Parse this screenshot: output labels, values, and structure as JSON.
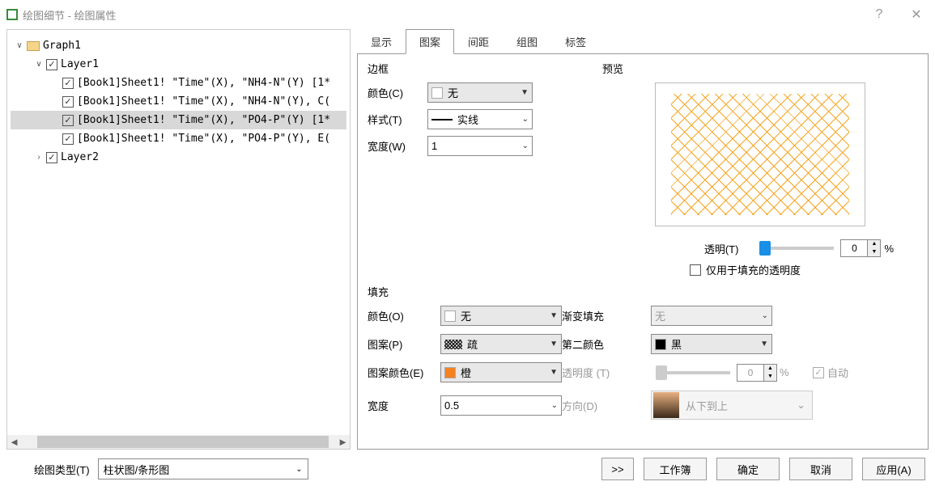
{
  "window": {
    "title": "绘图细节 - 绘图属性",
    "help": "?",
    "close": "✕"
  },
  "tree": {
    "root": "Graph1",
    "layer1": "Layer1",
    "layer2": "Layer2",
    "items": [
      "[Book1]Sheet1! \"Time\"(X), \"NH4-N\"(Y) [1*",
      "[Book1]Sheet1! \"Time\"(X), \"NH4-N\"(Y), C(",
      "[Book1]Sheet1! \"Time\"(X), \"PO4-P\"(Y) [1*",
      "[Book1]Sheet1! \"Time\"(X), \"PO4-P\"(Y), E("
    ]
  },
  "tabs": [
    "显示",
    "图案",
    "间距",
    "组图",
    "标签"
  ],
  "border": {
    "legend": "边框",
    "color_label": "颜色(C)",
    "color_value": "无",
    "style_label": "样式(T)",
    "style_value": "实线",
    "width_label": "宽度(W)",
    "width_value": "1"
  },
  "preview": {
    "legend": "预览"
  },
  "transparency": {
    "label": "透明(T)",
    "value": "0",
    "pct": "%",
    "fill_only": "仅用于填充的透明度"
  },
  "fill": {
    "legend": "填充",
    "color_label": "颜色(O)",
    "color_value": "无",
    "pattern_label": "图案(P)",
    "pattern_value": "疏",
    "pattern_color_label": "图案颜色(E)",
    "pattern_color_value": "橙",
    "width_label": "宽度",
    "width_value": "0.5",
    "gradient_label": "渐变填充",
    "gradient_value": "无",
    "second_color_label": "第二颜色",
    "second_color_value": "黑",
    "transparency2_label": "透明度 (T)",
    "transparency2_value": "0",
    "auto": "自动",
    "direction_label": "方向(D)",
    "direction_value": "从下到上"
  },
  "bottom": {
    "plot_type_label": "绘图类型(T)",
    "plot_type_value": "柱状图/条形图",
    "expand": ">>",
    "workbook": "工作簿",
    "ok": "确定",
    "cancel": "取消",
    "apply": "应用(A)"
  }
}
